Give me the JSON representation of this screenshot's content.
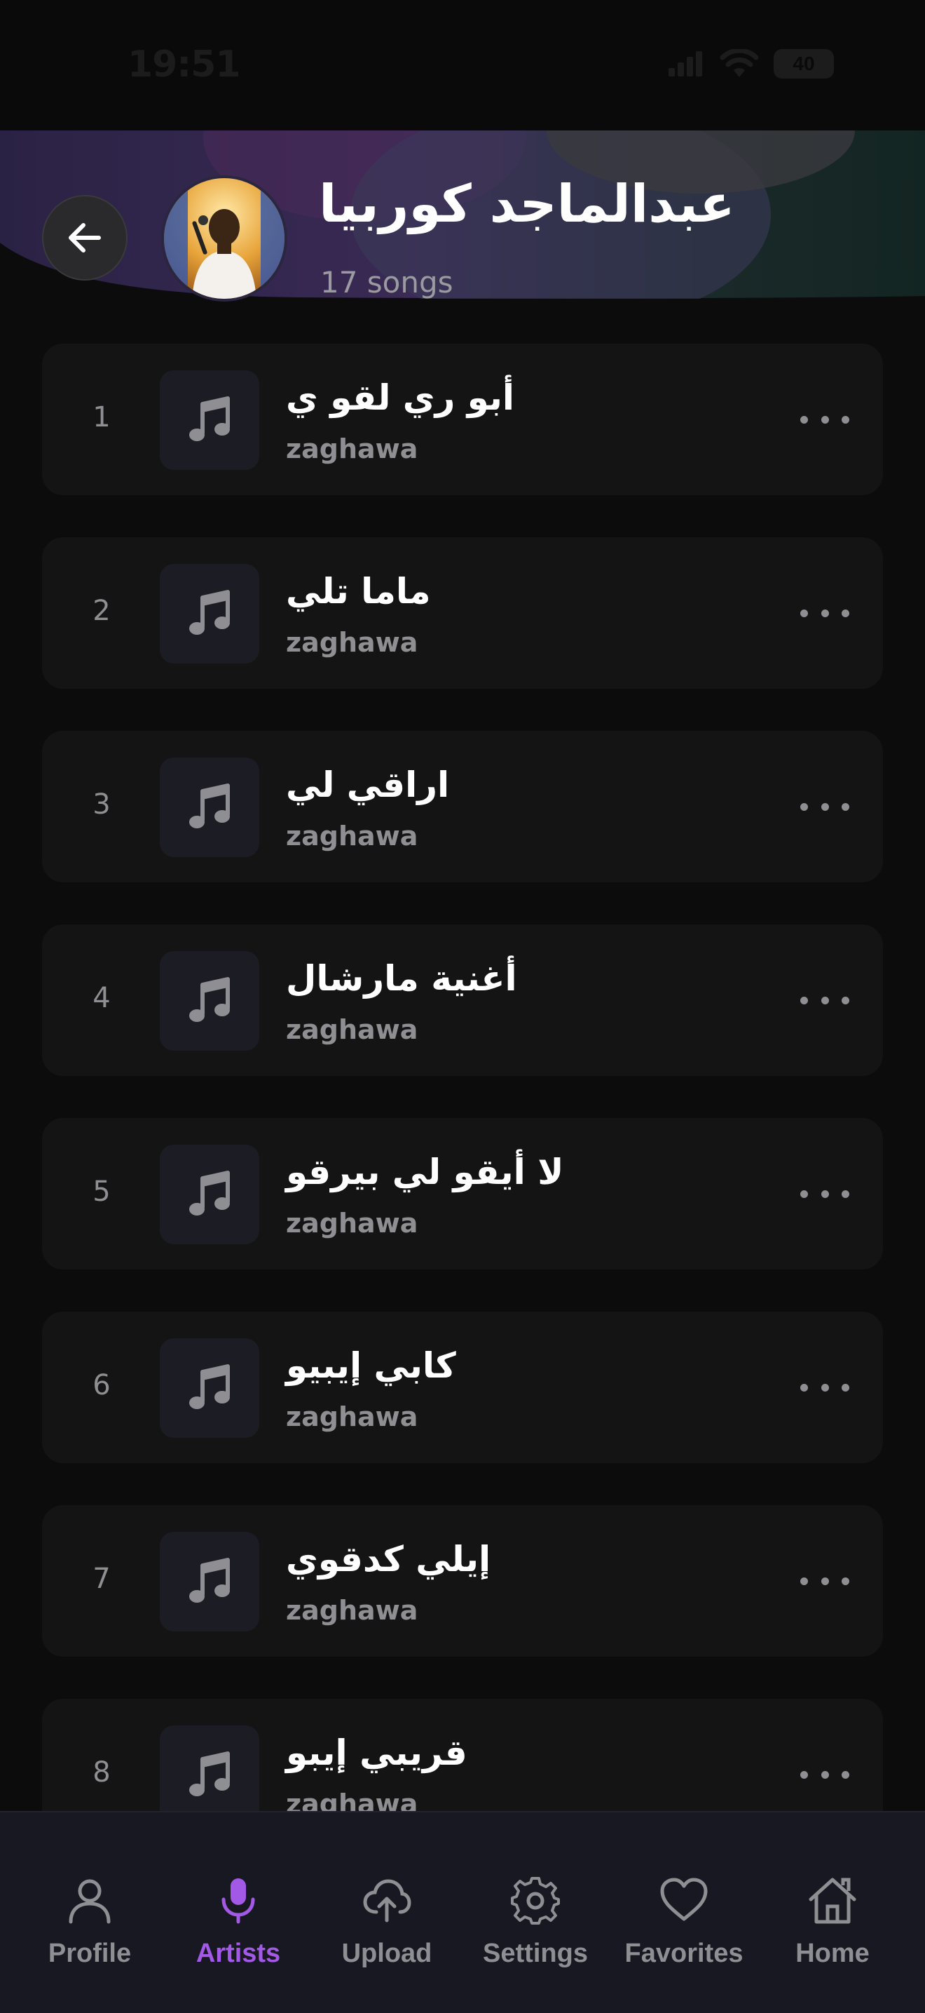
{
  "status_bar": {
    "time": "19:51",
    "battery": "40"
  },
  "header": {
    "artist_name": "عبدالماجد كوربيا",
    "song_count": "17 songs"
  },
  "songs": [
    {
      "number": "1",
      "title": "أبو ري لقو ي",
      "subtitle": "zaghawa"
    },
    {
      "number": "2",
      "title": "ماما تلي",
      "subtitle": "zaghawa"
    },
    {
      "number": "3",
      "title": "اراقي لي",
      "subtitle": "zaghawa"
    },
    {
      "number": "4",
      "title": "أغنية مارشال",
      "subtitle": "zaghawa"
    },
    {
      "number": "5",
      "title": "لا أيقو لي بيرقو",
      "subtitle": "zaghawa"
    },
    {
      "number": "6",
      "title": "كابي إيبيو",
      "subtitle": "zaghawa"
    },
    {
      "number": "7",
      "title": "إيلي كدقوي",
      "subtitle": "zaghawa"
    },
    {
      "number": "8",
      "title": "قريبي إيبو",
      "subtitle": "zaghawa"
    }
  ],
  "nav": {
    "items": [
      {
        "label": "Profile",
        "icon": "person-icon"
      },
      {
        "label": "Artists",
        "icon": "microphone-icon"
      },
      {
        "label": "Upload",
        "icon": "cloud-upload-icon"
      },
      {
        "label": "Settings",
        "icon": "gear-icon"
      },
      {
        "label": "Favorites",
        "icon": "heart-icon"
      },
      {
        "label": "Home",
        "icon": "home-icon"
      }
    ],
    "active": "Artists"
  },
  "colors": {
    "background": "#0c0c0d",
    "row": "#141414",
    "accent": "#a259e6",
    "muted": "#8e8e93"
  }
}
